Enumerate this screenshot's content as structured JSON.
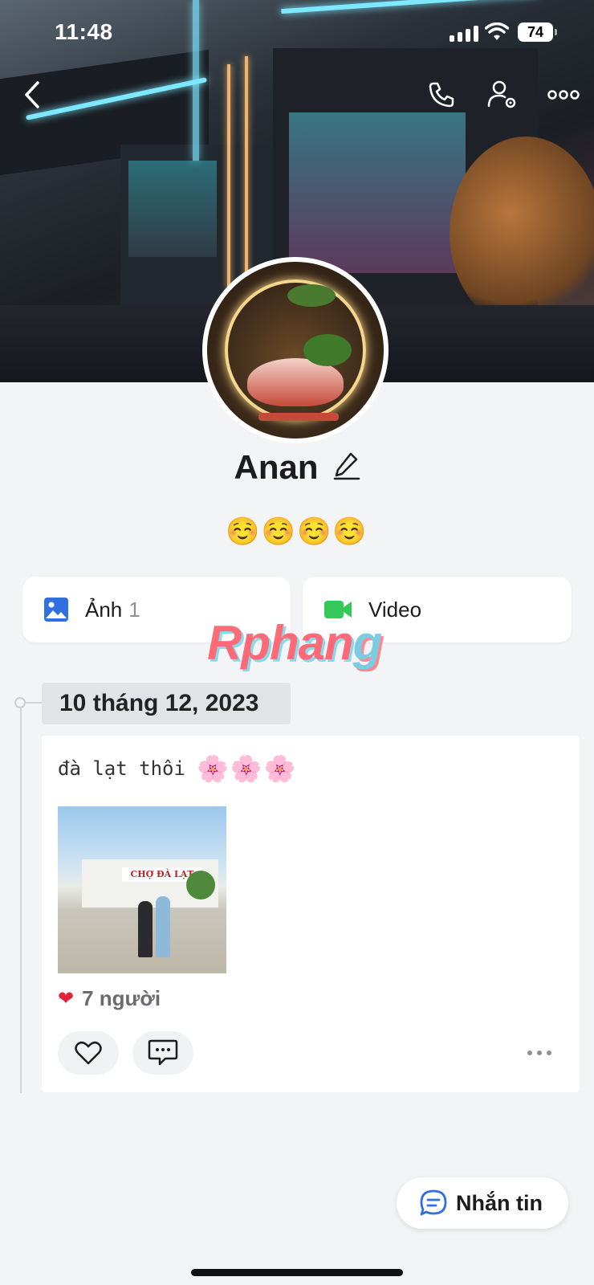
{
  "status_bar": {
    "time": "11:48",
    "battery": "74"
  },
  "profile": {
    "name": "Anan",
    "bio": "☺️☺️☺️☺️"
  },
  "media_tabs": [
    {
      "label": "Ảnh",
      "count": "1"
    },
    {
      "label": "Video"
    }
  ],
  "watermark": {
    "text_a": "Rphan",
    "text_b": "g"
  },
  "timeline": {
    "date": "10 tháng 12, 2023",
    "post": {
      "text": "đà lạt thôi",
      "emoji": "🌸🌸🌸",
      "photo_sign": "CHỢ ĐÀ LẠT",
      "likes_heart": "❤",
      "likes_text": "7 người"
    }
  },
  "fab": {
    "label": "Nhắn tin"
  },
  "colors": {
    "accent_blue": "#2f6fe0",
    "video_green": "#34c759",
    "heart_red": "#e0243a"
  }
}
